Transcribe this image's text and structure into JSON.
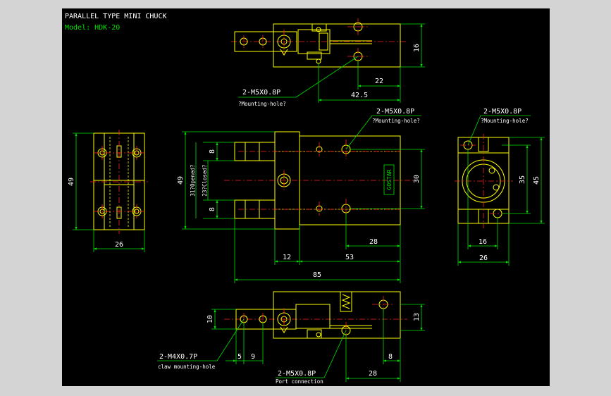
{
  "title": "PARALLEL TYPE MINI CHUCK",
  "model": "Model: HDK-20",
  "colors": {
    "background": "#000000",
    "frame": "#d4d4d4",
    "outline": "#ffff00",
    "center": "#ff2020",
    "dimension": "#00e000",
    "text": "#ffffff"
  },
  "top_view": {
    "dim_16": "16",
    "dim_22": "22",
    "dim_42_5": "42.5",
    "note_thread": "2-M5X0.8P",
    "note_desc": "?Mounting-hole?"
  },
  "front_view": {
    "dim_49": "49",
    "dim_8_top": "8",
    "dim_8_bottom": "8",
    "dim_opened": "31?Opened?",
    "dim_closed": "23?Closed?",
    "dim_30": "30",
    "dim_28": "28",
    "dim_12": "12",
    "dim_53": "53",
    "dim_85": "85",
    "note_thread": "2-M5X0.8P",
    "note_desc": "?Mounting-hole?",
    "logo": "GOSTAR"
  },
  "left_view": {
    "dim_49": "49",
    "dim_26": "26"
  },
  "right_view": {
    "dim_35": "35",
    "dim_45": "45",
    "dim_16": "16",
    "dim_26": "26",
    "note_thread": "2-M5X0.8P",
    "note_desc": "?Mounting-hole?"
  },
  "bottom_view": {
    "dim_10": "10",
    "dim_13": "13",
    "dim_5": "5",
    "dim_9": "9",
    "dim_8": "8",
    "dim_28": "28",
    "note_claw_thread": "2-M4X0.7P",
    "note_claw_desc": "claw mounting-hole",
    "note_port_thread": "2-M5X0.8P",
    "note_port_desc": "Port connection"
  }
}
